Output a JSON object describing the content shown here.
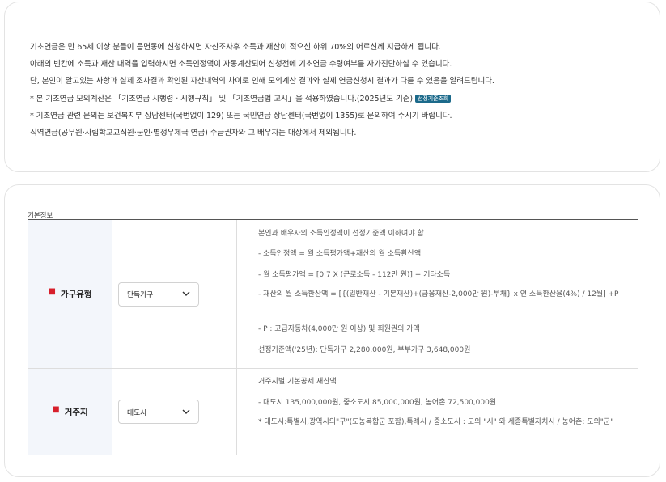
{
  "notice": {
    "lines": [
      "기초연금은 만 65세 이상 분들이 읍면동에 신청하시면 자산조사후 소득과 재산이 적으신 하위 70%의 어르신께 지급하게 됩니다.",
      "아래의 빈칸에 소득과 재산 내역을 입력하시면 소득인정액이 자동계산되어 신청전에 기초연금 수령여부를 자가진단하실 수 있습니다.",
      "단, 본인이 알고있는 사항과 실제 조사결과 확인된 자산내역의 차이로 인해 모의계산 결과와 실제 연금신청시 결과가 다를 수 있음을 알려드립니다.",
      "* 본 기초연금 모의계산은 「기초연금 시행령 · 시행규칙」 및 「기초연금법 고시」을 적용하였습니다.(2025년도 기준)",
      "* 기초연금 관련 문의는 보건복지부 상담센터(국번없이 129) 또는 국민연금 상담센터(국번없이 1355)로 문의하여 주시기 바랍니다.",
      "직역연금(공무원·사립학교교직원·군인·별정우체국 연금) 수급권자와 그 배우자는 대상에서 제외됩니다."
    ],
    "badge_label": "선정기준조회"
  },
  "form": {
    "section_title": "기본정보",
    "required_mark": "■",
    "household": {
      "label": "가구유형",
      "selected": "단독가구",
      "desc": [
        "본인과 배우자의 소득인정액이 선정기준액 이하여야 함",
        "- 소득인정액 = 월 소득평가액+재산의 월 소득환산액",
        "- 월 소득평가액 = [0.7 X (근로소득 - 112만 원)] + 기타소득",
        "- 재산의 월 소득환산액 = [{(일반재산 - 기본재산)+(금융재산-2,000만 원)-부채} x 연 소득환산율(4%) / 12월] +P",
        "- P : 고급자동차(4,000만 원 이상) 및 회원권의 가액",
        "선정기준액('25년): 단독가구 2,280,000원, 부부가구 3,648,000원"
      ]
    },
    "residence": {
      "label": "거주지",
      "selected": "대도시",
      "desc": [
        "거주지별 기본공제 재산액",
        "- 대도시 135,000,000원, 중소도시 85,000,000원, 농어촌 72,500,000원",
        "* 대도시:특별시,광역시의\"구\"(도농복합군 포함),특례시 / 중소도시 : 도의 \"시\" 와 세종특별자치시 / 농어촌: 도의\"군\""
      ]
    }
  },
  "icons": {
    "select_arrow": "chevron-down-icon"
  },
  "colors": {
    "badge": "#1c6a8b",
    "required": "#d71f2b",
    "label_bg": "#f3f6fb"
  }
}
